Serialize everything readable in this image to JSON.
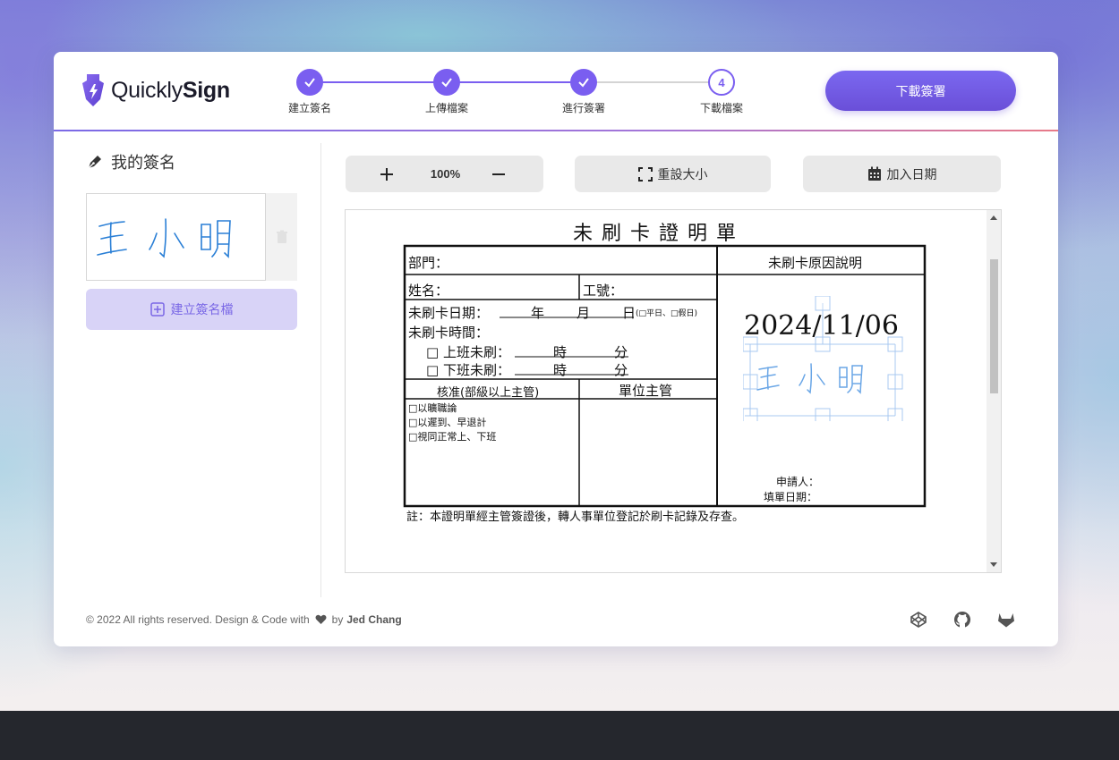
{
  "app": {
    "logo_text_light": "Quickly",
    "logo_text_bold": "Sign",
    "accent_color": "#7a5ef0"
  },
  "steps": [
    {
      "label": "建立簽名",
      "state": "done"
    },
    {
      "label": "上傳檔案",
      "state": "done"
    },
    {
      "label": "進行簽署",
      "state": "done"
    },
    {
      "label": "下載檔案",
      "state": "current",
      "number": "4"
    }
  ],
  "header": {
    "download_label": "下載簽署"
  },
  "sidebar": {
    "title": "我的簽名",
    "signature_text": "王 小 明",
    "create_label": "建立簽名檔"
  },
  "toolbar": {
    "zoom_value": "100%",
    "reset_label": "重設大小",
    "add_date_label": "加入日期"
  },
  "document": {
    "title": "未刷卡證明單",
    "reason_header": "未刷卡原因說明",
    "dept": "部門：",
    "name": "姓名：",
    "emp_no": "工號：",
    "date_label": "未刷卡日期：",
    "year": "年",
    "month": "月",
    "day": "日",
    "day_type": "(□平日、□假日)",
    "time_label": "未刷卡時間：",
    "in_label": "□ 上班未刷：",
    "out_label": "□ 下班未刷：",
    "hour": "時",
    "minute": "分",
    "approve_header": "核准(部級以上主管)",
    "unit_header": "單位主管",
    "opt1": "□以曠職論",
    "opt2": "□以遲到、早退計",
    "opt3": "□視同正常上、下班",
    "applicant": "申請人：",
    "fill_date": "填單日期：",
    "note": "註：本證明單經主管簽證後，轉人事單位登記於刷卡記錄及存查。",
    "stamp_date": "2024/11/06",
    "stamp_signature": "王 小 明"
  },
  "footer": {
    "copyright": "© 2022 All rights reserved. Design & Code with",
    "by": "by",
    "author": "Jed Chang",
    "icons": [
      "codepen-icon",
      "github-icon",
      "gitlab-icon"
    ]
  }
}
